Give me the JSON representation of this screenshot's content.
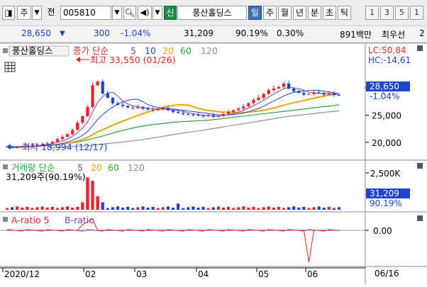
{
  "toolbar": {
    "market_select": "주",
    "label_jeon": "전",
    "code_value": "005810",
    "tag_sin": "신",
    "stock_name": "풍산홀딩스",
    "periods": [
      "일",
      "주",
      "월",
      "년",
      "분",
      "초",
      "틱"
    ],
    "selected_period": "일",
    "numbers": [
      "1",
      "3",
      "5",
      "1"
    ]
  },
  "info": {
    "price": "28,650",
    "change": "300",
    "change_pct": "-1.04%",
    "volume": "31,209",
    "vol_ratio": "90.19%",
    "turnover": "0.30%",
    "amount": "891백만",
    "best_quote": "최우선",
    "best_quote_value": "2"
  },
  "colors": {
    "up": "#e8232a",
    "down": "#1f44d0",
    "ma5": "#7b3fb0",
    "ma20": "#f2a400",
    "ma60": "#2aa53c",
    "ma120": "#8c8c8c"
  },
  "price_pane": {
    "stock_label": "풍산홀딩스",
    "legend_prefix": "종가 단순",
    "legend_periods": [
      "5",
      "10",
      "20",
      "60",
      "120"
    ],
    "lc": "LC:50,84",
    "hc": "HC:-14,61",
    "high_annot": "최고 33,550 (01/26)",
    "low_annot": "최저 18,994 (12/17)",
    "current_price": "28,650",
    "current_pct": "-1.04%"
  },
  "volume_pane": {
    "legend_prefix": "거래량 단순",
    "legend_periods": [
      "5",
      "20",
      "60",
      "120"
    ],
    "summary": "31,209주(90.19%)",
    "current_volume": "31,209",
    "current_pct": "90.19%"
  },
  "ratio_pane": {
    "legend_a": "A-ratio 5",
    "legend_b": "B-ratio",
    "axis_zero": "0.00"
  },
  "x_axis": {
    "labels": [
      "2020/12",
      "02",
      "03",
      "04",
      "05",
      "06"
    ],
    "right_label": "06/16"
  },
  "chart_data": {
    "type": "candlestick",
    "price_ticks": [
      "30,000",
      "25,000",
      "20,000"
    ],
    "volume_ticks": [
      "2,500K"
    ],
    "ratio_ticks": [
      "0.00"
    ],
    "price_range": [
      17500,
      35500
    ],
    "high": {
      "value": 33550,
      "date": "01/26"
    },
    "low": {
      "value": 18994,
      "date": "12/17"
    },
    "last_close": 28650,
    "close_series": [
      19200,
      18994,
      19100,
      19300,
      19400,
      19500,
      19600,
      19700,
      19800,
      20100,
      20600,
      21000,
      21500,
      22300,
      23600,
      24800,
      26500,
      30500,
      31200,
      29000,
      28200,
      27200,
      26900,
      26700,
      26400,
      26300,
      26500,
      26200,
      26000,
      25900,
      26100,
      26300,
      25900,
      25600,
      25400,
      25200,
      25100,
      25000,
      24900,
      24800,
      25000,
      24700,
      24900,
      25200,
      25600,
      25900,
      26200,
      26600,
      27200,
      27800,
      28200,
      28900,
      29600,
      29900,
      30200,
      30800,
      29900,
      29400,
      29100,
      28800,
      28900,
      29200,
      29100,
      28800,
      28950,
      28700,
      28650
    ],
    "ma60": [
      19300,
      19400,
      19500,
      19700,
      19900,
      20200,
      20600,
      21000,
      21500,
      22000,
      22400,
      22800,
      23100,
      23300,
      23500,
      23700,
      23800,
      23900,
      24000,
      24100,
      24300,
      24500,
      24700,
      24900,
      25100,
      25300,
      25500,
      25700,
      25900,
      26100,
      26300,
      26500,
      26700,
      26900
    ],
    "ma120": [
      19000,
      19100,
      19200,
      19300,
      19400,
      19600,
      19800,
      20000,
      20200,
      20400,
      20700,
      21000,
      21300,
      21600,
      21900,
      22100,
      22400,
      22700,
      23000,
      23300,
      23600,
      23900,
      24200,
      24500,
      24800,
      25000,
      25200,
      25400,
      25600,
      25800
    ]
  }
}
